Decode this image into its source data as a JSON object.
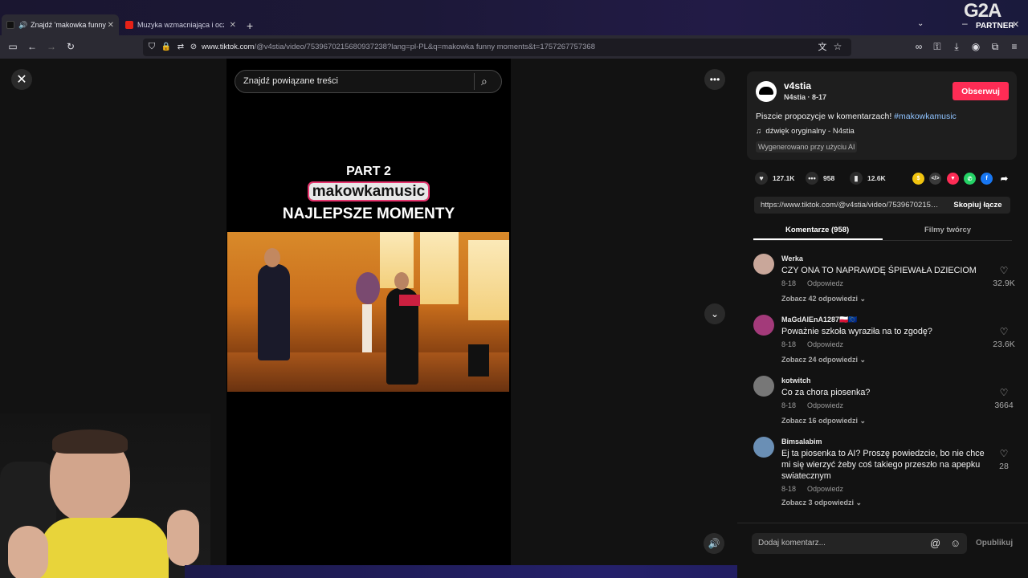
{
  "browser": {
    "tabs": [
      {
        "label": "Znajdź 'makowka funny m",
        "active": true
      },
      {
        "label": "Muzyka wzmacniająca i oczyszc",
        "active": false
      }
    ],
    "url_host": "www.tiktok.com",
    "url_path": "/@v4stia/video/7539670215680937238?lang=pl-PL&q=makowka funny moments&t=1757267757368"
  },
  "overlay": {
    "brand": "G2A",
    "brand_sub": "PARTNER"
  },
  "video": {
    "search_placeholder": "Znajdź powiązane treści",
    "caption_line1": "PART 2",
    "caption_line2": "makowkamusic",
    "caption_line3": "NAJLEPSZE MOMENTY"
  },
  "post": {
    "username": "v4stia",
    "subline": "N4stia · 8-17",
    "follow_label": "Obserwuj",
    "description": "Piszcie propozycje w komentarzach!",
    "hashtag": "#makowkamusic",
    "sound": "dźwięk oryginalny - N4stia",
    "ai_badge": "Wygenerowano przy użyciu AI",
    "likes": "127.1K",
    "comments": "958",
    "saves": "12.6K",
    "link": "https://www.tiktok.com/@v4stia/video/7539670215680937238",
    "copy_label": "Skopiuj łącze"
  },
  "panel_tabs": {
    "comments": "Komentarze (958)",
    "creator": "Filmy twórcy"
  },
  "comments": [
    {
      "user": "Werka",
      "text": "CZY ONA TO NAPRAWDĘ ŚPIEWAŁA DZIECIOM",
      "date": "8-18",
      "reply": "Odpowiedz",
      "replies": "Zobacz 42 odpowiedzi",
      "likes": "32.9K",
      "avatar_color": "#c9a79a"
    },
    {
      "user": "MaGdAlEnA1287🇵🇱🇪🇺",
      "text": "Poważnie szkoła wyraziła na to zgodę?",
      "date": "8-18",
      "reply": "Odpowiedz",
      "replies": "Zobacz 24 odpowiedzi",
      "likes": "23.6K",
      "avatar_color": "#a33a7a"
    },
    {
      "user": "kotwitch",
      "text": "Co za chora piosenka?",
      "date": "8-18",
      "reply": "Odpowiedz",
      "replies": "Zobacz 16 odpowiedzi",
      "likes": "3664",
      "avatar_color": "#777777"
    },
    {
      "user": "Bimsalabim",
      "text": "Ej ta piosenka to AI? Proszę powiedzcie, bo nie chce mi się wierzyć żeby coś takiego przeszło na apepku swiatecznym",
      "date": "8-18",
      "reply": "Odpowiedz",
      "replies": "Zobacz 3 odpowiedzi",
      "likes": "28",
      "avatar_color": "#6a8fb5"
    }
  ],
  "comment_input": {
    "placeholder": "Dodaj komentarz...",
    "publish": "Opublikuj"
  },
  "colors": {
    "accent": "#fe2c55",
    "hashtag": "#8fc3ff"
  }
}
